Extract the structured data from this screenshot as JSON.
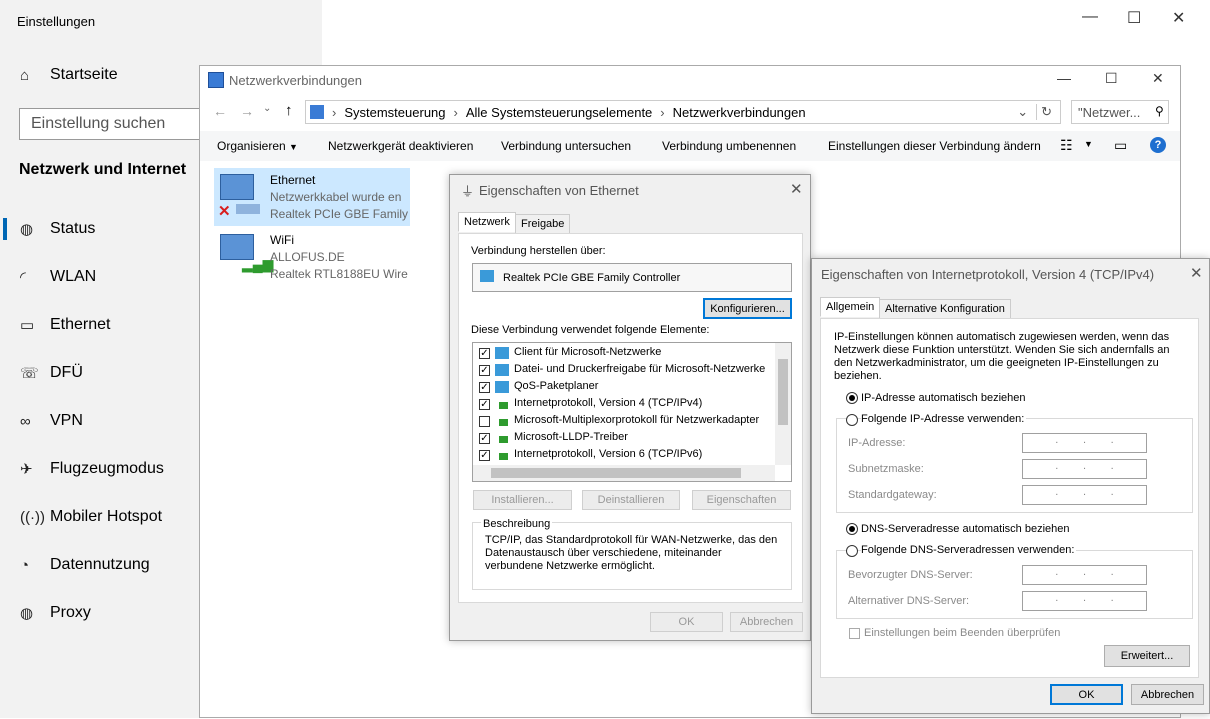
{
  "settings": {
    "title": "Einstellungen",
    "home": "Startseite",
    "search_placeholder": "Einstellung suchen",
    "section": "Netzwerk und Internet",
    "nav": [
      {
        "label": "Status",
        "icon": "globe-icon"
      },
      {
        "label": "WLAN",
        "icon": "wifi-icon"
      },
      {
        "label": "Ethernet",
        "icon": "ethernet-icon"
      },
      {
        "label": "DFÜ",
        "icon": "dialup-icon"
      },
      {
        "label": "VPN",
        "icon": "vpn-icon"
      },
      {
        "label": "Flugzeugmodus",
        "icon": "airplane-icon"
      },
      {
        "label": "Mobiler Hotspot",
        "icon": "hotspot-icon"
      },
      {
        "label": "Datennutzung",
        "icon": "data-usage-icon"
      },
      {
        "label": "Proxy",
        "icon": "globe-icon"
      }
    ]
  },
  "netwin": {
    "title": "Netzwerkverbindungen",
    "breadcrumb": [
      "Systemsteuerung",
      "Alle Systemsteuerungselemente",
      "Netzwerkverbindungen"
    ],
    "search_placeholder": "\"Netzwer...",
    "toolbar": [
      "Organisieren",
      "Netzwerkgerät deaktivieren",
      "Verbindung untersuchen",
      "Verbindung umbenennen",
      "Einstellungen dieser Verbindung ändern"
    ],
    "connections": [
      {
        "name": "Ethernet",
        "status": "Netzwerkkabel wurde en",
        "device": "Realtek PCIe GBE Family"
      },
      {
        "name": "WiFi",
        "status": "ALLOFUS.DE",
        "device": "Realtek RTL8188EU Wire"
      }
    ]
  },
  "eth": {
    "title": "Eigenschaften von Ethernet",
    "tabs": [
      "Netzwerk",
      "Freigabe"
    ],
    "connect_label": "Verbindung herstellen über:",
    "adapter": "Realtek PCIe GBE Family Controller",
    "configure": "Konfigurieren...",
    "elements_label": "Diese Verbindung verwendet folgende Elemente:",
    "elements": [
      {
        "label": "Client für Microsoft-Netzwerke",
        "checked": true
      },
      {
        "label": "Datei- und Druckerfreigabe für Microsoft-Netzwerke",
        "checked": true
      },
      {
        "label": "QoS-Paketplaner",
        "checked": true
      },
      {
        "label": "Internetprotokoll, Version 4 (TCP/IPv4)",
        "checked": true
      },
      {
        "label": "Microsoft-Multiplexorprotokoll für Netzwerkadapter",
        "checked": false
      },
      {
        "label": "Microsoft-LLDP-Treiber",
        "checked": true
      },
      {
        "label": "Internetprotokoll, Version 6 (TCP/IPv6)",
        "checked": true
      }
    ],
    "install": "Installieren...",
    "uninstall": "Deinstallieren",
    "properties": "Eigenschaften",
    "desc_title": "Beschreibung",
    "desc": "TCP/IP, das Standardprotokoll für WAN-Netzwerke, das den Datenaustausch über verschiedene, miteinander verbundene Netzwerke ermöglicht.",
    "ok": "OK",
    "cancel": "Abbrechen"
  },
  "ipv4": {
    "title": "Eigenschaften von Internetprotokoll, Version 4 (TCP/IPv4)",
    "tabs": [
      "Allgemein",
      "Alternative Konfiguration"
    ],
    "intro": "IP-Einstellungen können automatisch zugewiesen werden, wenn das Netzwerk diese Funktion unterstützt. Wenden Sie sich andernfalls an den Netzwerkadministrator, um die geeigneten IP-Einstellungen zu beziehen.",
    "ip_auto": "IP-Adresse automatisch beziehen",
    "ip_manual": "Folgende IP-Adresse verwenden:",
    "ip_address": "IP-Adresse:",
    "subnet": "Subnetzmaske:",
    "gateway": "Standardgateway:",
    "dns_auto": "DNS-Serveradresse automatisch beziehen",
    "dns_manual": "Folgende DNS-Serveradressen verwenden:",
    "dns_pref": "Bevorzugter DNS-Server:",
    "dns_alt": "Alternativer DNS-Server:",
    "validate": "Einstellungen beim Beenden überprüfen",
    "advanced": "Erweitert...",
    "ok": "OK",
    "cancel": "Abbrechen"
  }
}
